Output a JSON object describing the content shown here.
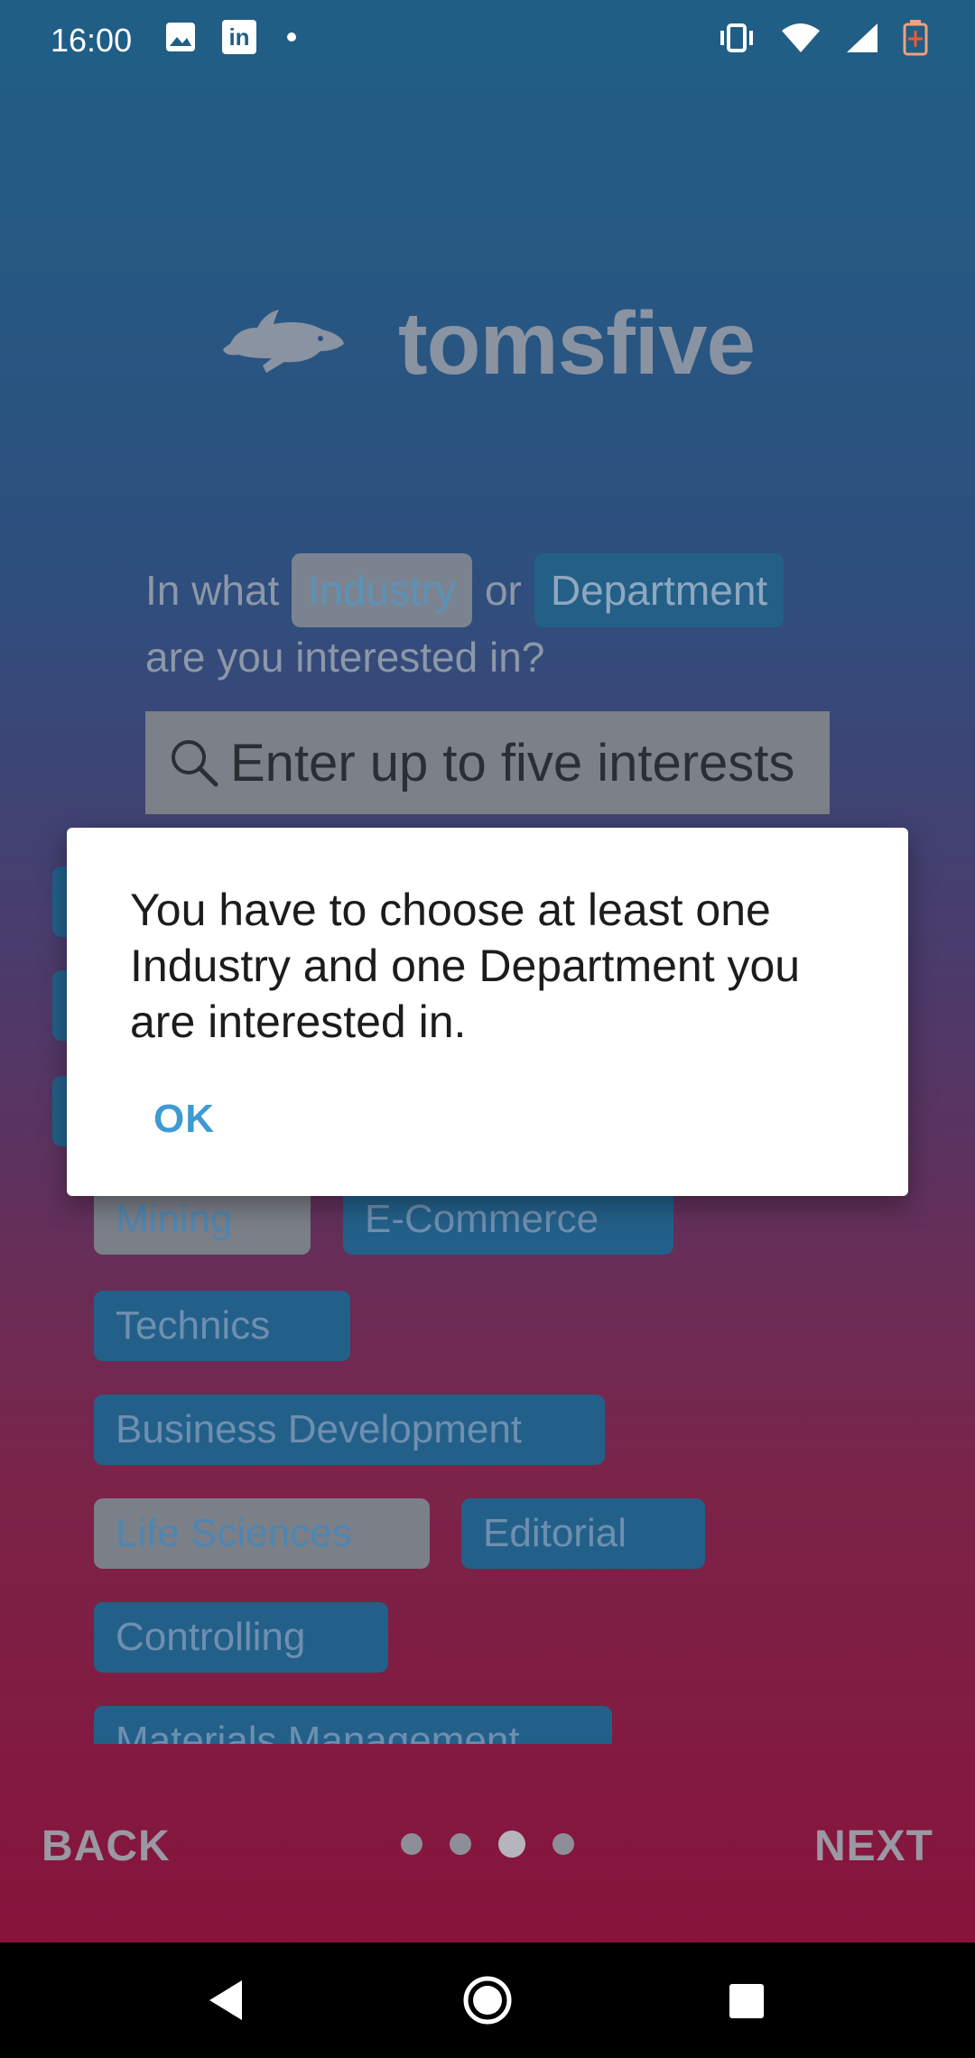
{
  "status_bar": {
    "time": "16:00",
    "left_icons": [
      "image-icon",
      "linkedin-icon",
      "dot-icon"
    ],
    "right_icons": [
      "vibrate-icon",
      "wifi-icon",
      "signal-icon",
      "battery-icon"
    ],
    "linkedin_glyph": "in"
  },
  "logo": {
    "name": "tomsfive",
    "icon": "rabbit-icon"
  },
  "question": {
    "prefix": "In what",
    "industry_pill": "Industry",
    "connector": "or",
    "department_pill": "Department",
    "suffix": "are you interested in?"
  },
  "search": {
    "placeholder": "Enter up to five interests"
  },
  "chips": [
    {
      "label": "Mining",
      "kind": "industry"
    },
    {
      "label": "E-Commerce",
      "kind": "department"
    },
    {
      "label": "Technics",
      "kind": "department"
    },
    {
      "label": "Business Development",
      "kind": "department"
    },
    {
      "label": "Life Sciences",
      "kind": "industry"
    },
    {
      "label": "Editorial",
      "kind": "department"
    },
    {
      "label": "Controlling",
      "kind": "department"
    },
    {
      "label": "Materials Management",
      "kind": "department"
    }
  ],
  "dialog": {
    "message": "You have to choose at least one Industry and one Department you are interested in.",
    "ok_label": "OK"
  },
  "footer": {
    "back_label": "BACK",
    "next_label": "NEXT",
    "page_count": 4,
    "current_page": 3
  },
  "colors": {
    "gradient_top": "#1f5f86",
    "gradient_bottom": "#8a0f37",
    "accent": "#3d9bd4"
  }
}
